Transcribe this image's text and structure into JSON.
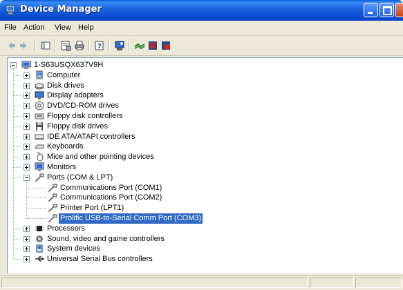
{
  "window": {
    "title": "Device Manager"
  },
  "menu": [
    "File",
    "Action",
    "View",
    "Help"
  ],
  "tree": {
    "root": "1-S63USQX637V9H",
    "categories": [
      "Computer",
      "Disk drives",
      "Display adapters",
      "DVD/CD-ROM drives",
      "Floppy disk controllers",
      "Floppy disk drives",
      "IDE ATA/ATAPI controllers",
      "Keyboards",
      "Mice and other pointing devices",
      "Monitors",
      "Ports (COM & LPT)",
      "Processors",
      "Sound, video and game controllers",
      "System devices",
      "Universal Serial Bus controllers"
    ],
    "ports_children": [
      "Communications Port (COM1)",
      "Communications Port (COM2)",
      "Printer Port (LPT1)",
      "Prolific USB-to-Serial Comm Port (COM3)"
    ],
    "selected": "Prolific USB-to-Serial Comm Port (COM3)"
  },
  "colors": {
    "selection": "#316ac5",
    "titlebar": "#0a5fd8"
  }
}
